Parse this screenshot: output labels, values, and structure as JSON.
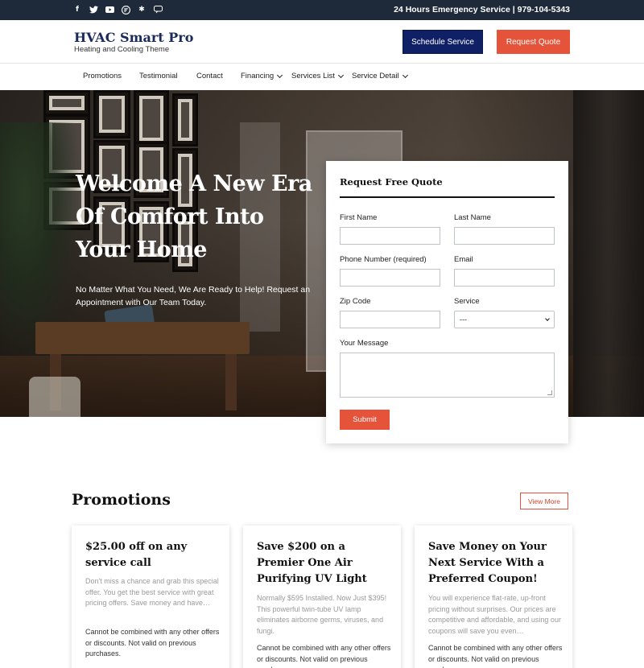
{
  "topbar": {
    "social_icons": [
      "facebook-icon",
      "twitter-icon",
      "youtube-icon",
      "foursquare-icon",
      "yelp-icon",
      "chat-icon"
    ],
    "emergency_text": "24 Hours Emergency Service | 979-104-5343"
  },
  "header": {
    "logo_title": "HVAC Smart Pro",
    "logo_subtitle": "Heating and Cooling Theme",
    "schedule_label": "Schedule Service",
    "quote_label": "Request Quote"
  },
  "nav": {
    "items": [
      {
        "label": "Promotions"
      },
      {
        "label": "Testimonial"
      },
      {
        "label": "Contact"
      },
      {
        "label": "Financing"
      },
      {
        "label": "Services List"
      },
      {
        "label": "Service Detail"
      }
    ]
  },
  "hero": {
    "title": "Welcome A New Era Of Comfort Into Your Home",
    "subtitle": "No Matter What You Need, We Are Ready to Help! Request an Appointment with Our Team Today."
  },
  "form": {
    "title": "Request Free Quote",
    "first_name_label": "First Name",
    "last_name_label": "Last Name",
    "phone_label": "Phone Number (required)",
    "email_label": "Email",
    "zip_label": "Zip Code",
    "service_label": "Service",
    "service_selected": "---",
    "message_label": "Your Message",
    "submit_label": "Submit"
  },
  "promotions": {
    "heading": "Promotions",
    "view_more_label": "View More",
    "cards": [
      {
        "title": "$25.00 off on any service call",
        "description": "Don't miss a chance and grab this special offer. You get the best service with great pricing offers. Save money and have…",
        "note": "Cannot be combined with any other offers or discounts. Not valid on previous purchases."
      },
      {
        "title": "Save $200 on a Premier One Air Purifying UV Light",
        "description": "Normally $595 Installed. Now Just $395! This powerful twin-tube UV lamp eliminates airborne germs, viruses, and fungi.",
        "note": "Cannot be combined with any other offers or discounts. Not valid on previous purchases."
      },
      {
        "title": "Save Money on Your Next Service With a Preferred Coupon!",
        "description": "You will experience flat-rate, up-front pricing without surprises. Our prices are competitive and affordable, and using our coupons will save you even…",
        "note": "Cannot be combined with any other offers or discounts. Not valid on previous purchases."
      }
    ]
  }
}
